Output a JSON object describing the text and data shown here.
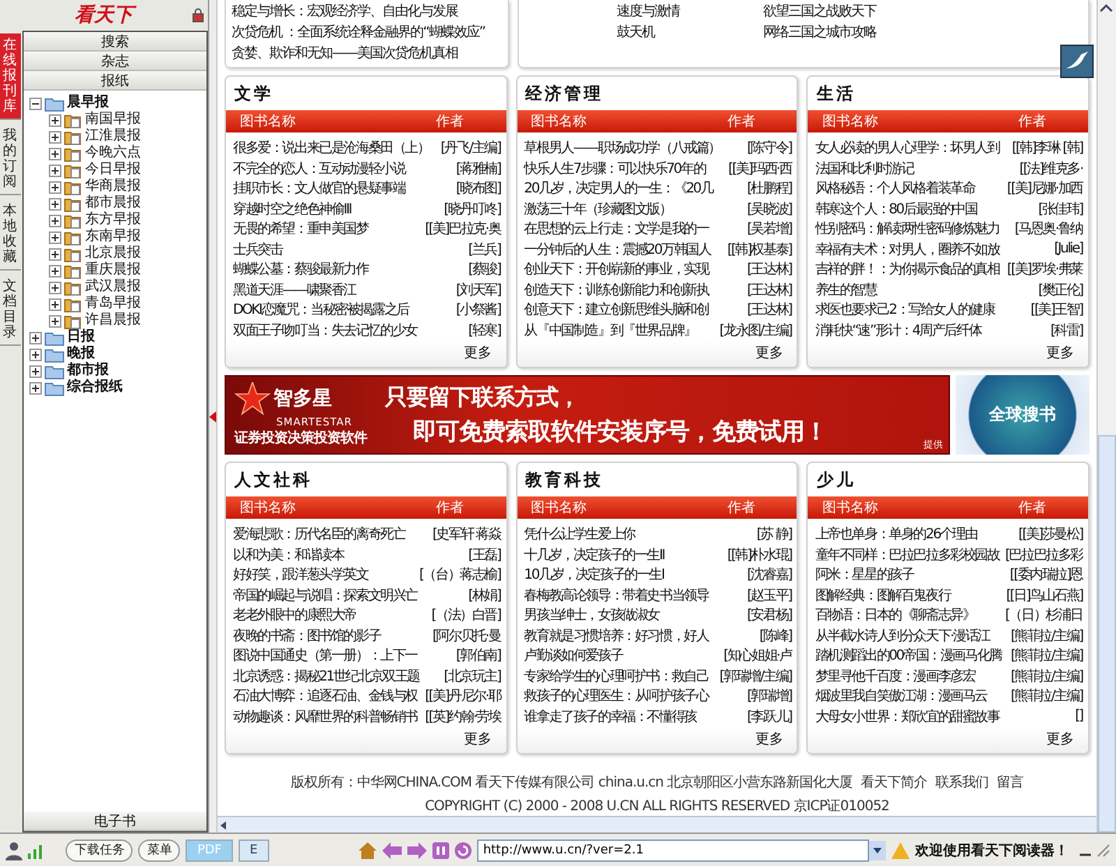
{
  "sidebar": {
    "logo": "看天下",
    "side_tabs": [
      {
        "label": "在线报刊库",
        "selected": true
      },
      {
        "label": "我的订阅",
        "selected": false
      },
      {
        "label": "本地收藏",
        "selected": false
      },
      {
        "label": "文档目录",
        "selected": false
      }
    ],
    "sections": [
      {
        "label": "搜索"
      },
      {
        "label": "杂志"
      },
      {
        "label": "报纸"
      }
    ],
    "tree": [
      {
        "label": "晨早报",
        "expanded": true,
        "children": [
          {
            "label": "南国早报",
            "expanded": false
          },
          {
            "label": "江淮晨报",
            "expanded": false
          },
          {
            "label": "今晚六点",
            "expanded": false
          },
          {
            "label": "今日早报",
            "expanded": false
          },
          {
            "label": "华商晨报",
            "expanded": false
          },
          {
            "label": "都市晨报",
            "expanded": false
          },
          {
            "label": "东方早报",
            "expanded": false
          },
          {
            "label": "东南早报",
            "expanded": false
          },
          {
            "label": "北京晨报",
            "expanded": false
          },
          {
            "label": "重庆晨报",
            "expanded": false
          },
          {
            "label": "武汉晨报",
            "expanded": false
          },
          {
            "label": "青岛早报",
            "expanded": false
          },
          {
            "label": "许昌晨报",
            "expanded": false
          }
        ]
      },
      {
        "label": "日报",
        "expanded": false
      },
      {
        "label": "晚报",
        "expanded": false
      },
      {
        "label": "都市报",
        "expanded": false
      },
      {
        "label": "综合报纸",
        "expanded": false
      }
    ],
    "bottom_section": "电子书"
  },
  "top_cards": {
    "left_lines": [
      "稳定与增长：宏观经济学、自由化与发展",
      "次贷危机 ：全面系统诠释金融界的“蝴蝶效应”",
      "贪婪、欺诈和无知——美国次贷危机真相"
    ],
    "right_column_1": [
      "速度与激情",
      "鼓天机"
    ],
    "right_column_2": [
      "欲望三国之战败天下",
      "网络三国之城市攻略"
    ]
  },
  "book_panels_1": [
    {
      "title": "文学",
      "columns": [
        "图书名称",
        "作者"
      ],
      "more": "更多",
      "rows": [
        {
          "title": "很多爱：说出来已是沧海桑田（上）",
          "author": "[丹飞/主编]"
        },
        {
          "title": "不完全的恋人：互动动漫轻小说",
          "author": "[蒋雅楠]"
        },
        {
          "title": "挂职市长：文人做官的悬疑事端",
          "author": "[晓布图]"
        },
        {
          "title": "穿越时空之绝色神偷III",
          "author": "[晓丹叮咚]"
        },
        {
          "title": "无畏的希望：重申美国梦",
          "author": "[[美]巴拉克·奥"
        },
        {
          "title": "士兵突击",
          "author": "[兰兵]"
        },
        {
          "title": "蝴蝶公墓：蔡骏最新力作",
          "author": "[蔡骏]"
        },
        {
          "title": "黑道天涯——啸聚香江",
          "author": "[刘天军]"
        },
        {
          "title": "DOKI恋魔咒：当秘密被揭露之后",
          "author": "[小祭酱]"
        },
        {
          "title": "双面王子吻叮当：失去记忆的少女",
          "author": "[轻寒]"
        }
      ]
    },
    {
      "title": "经济管理",
      "columns": [
        "图书名称",
        "作者"
      ],
      "more": "更多",
      "rows": [
        {
          "title": "草根男人——职场成功学（八戒篇）",
          "author": "[陈守令]"
        },
        {
          "title": "快乐人生7步骤：可以快乐70年的",
          "author": "[[美]玛西·西"
        },
        {
          "title": "20几岁，决定男人的一生：《20几",
          "author": "[杜鹏程]"
        },
        {
          "title": "激荡三十年（珍藏图文版）",
          "author": "[吴晓波]"
        },
        {
          "title": "在思想的云上行走：文学是我的一",
          "author": "[吴若增]"
        },
        {
          "title": "一分钟后的人生：震撼20万韩国人",
          "author": "[[韩]权基泰]"
        },
        {
          "title": "创业天下：开创崭新的事业，实现",
          "author": "[王达林]"
        },
        {
          "title": "创造天下：训练创新能力和创新执",
          "author": "[王达林]"
        },
        {
          "title": "创意天下：建立创新思维头脑和创",
          "author": "[王达林]"
        },
        {
          "title": "从『中国制造』到『世界品牌』",
          "author": "[龙永图/主编]"
        }
      ]
    },
    {
      "title": "生活",
      "columns": [
        "图书名称",
        "作者"
      ],
      "more": "更多",
      "rows": [
        {
          "title": "女人必读的男人心理学：坏男人到",
          "author": "[[韩]李琳 [韩]"
        },
        {
          "title": "法国和比利时游记",
          "author": "[[法]维克多·"
        },
        {
          "title": "风格秘语：个人风格着装革命",
          "author": "[[美]尼娜·加西"
        },
        {
          "title": "韩寒这个人：80后最强的中国",
          "author": "[张佳玮]"
        },
        {
          "title": "性别密码：解读两性密码修炼魅力",
          "author": "[马恩奥·鲁纳"
        },
        {
          "title": "幸福有夫术：对男人，圈养不如放",
          "author": "[Julie]"
        },
        {
          "title": "吉祥的胖！：为你揭示食品的真相",
          "author": "[[美]罗埃·弗莱"
        },
        {
          "title": "养生的智慧",
          "author": "[樊正伦]"
        },
        {
          "title": "求医也要求己2：写给女人的健康",
          "author": "[[美]王智]"
        },
        {
          "title": "消耗快“速”形计：4周产后纤体",
          "author": "[科雷]"
        }
      ]
    }
  ],
  "ad_banner": {
    "brand": "智多星",
    "brand_latin": "SMARTESTAR",
    "tagline": "证券投资决策投资软件",
    "headline_1": "只要留下联系方式，",
    "headline_2": "即可免费索取软件安装序号，免费试用！",
    "credit": "提供",
    "side_badge": "全球搜书"
  },
  "book_panels_2": [
    {
      "title": "人文社科",
      "columns": [
        "图书名称",
        "作者"
      ],
      "more": "更多",
      "rows": [
        {
          "title": "爱海悲歌：历代名臣的离奇死亡",
          "author": "[史军轩 蒋焱"
        },
        {
          "title": "以和为美：和谐读本",
          "author": "[王磊]"
        },
        {
          "title": "好好笑，跟洋葱头学英文",
          "author": "[（台）蒋志榆]"
        },
        {
          "title": "帝国的崛起与说唱：探索文明兴亡",
          "author": "[林娟]"
        },
        {
          "title": "老老外眼中的康熙大帝",
          "author": "[（法）白晋]"
        },
        {
          "title": "夜晚的书斋：图书馆的影子",
          "author": "[阿尔贝托·曼"
        },
        {
          "title": "图说中国通史（第一册）：上下一",
          "author": "[郭伯南]"
        },
        {
          "title": "北京诱惑：揭秘21世纪北京双王题",
          "author": "[北京玩主]"
        },
        {
          "title": "石油大博弈：追逐石油、金钱与权",
          "author": "[[美]丹尼尔·耶"
        },
        {
          "title": "动物趣谈：风靡世界的科普畅销书",
          "author": "[[英]约翰·劳埃"
        }
      ]
    },
    {
      "title": "教育科技",
      "columns": [
        "图书名称",
        "作者"
      ],
      "more": "更多",
      "rows": [
        {
          "title": "凭什么让学生爱上你",
          "author": "[苏 静]"
        },
        {
          "title": "十几岁，决定孩子的一生II",
          "author": "[[韩]朴水琨]"
        },
        {
          "title": "10几岁，决定孩子的一生I",
          "author": "[沈睿嘉]"
        },
        {
          "title": "春梅教高论领导：带着史书当领导",
          "author": "[赵玉平]"
        },
        {
          "title": "男孩当绅士，女孩做淑女",
          "author": "[安君杨]"
        },
        {
          "title": "教育就是习惯培养：好习惯，好人",
          "author": "[陈峰]"
        },
        {
          "title": "卢勤谈如何爱孩子",
          "author": "[知心姐姐·卢"
        },
        {
          "title": "专家给学生的心理呵护书：救自己",
          "author": "[郭瑞增/主编]"
        },
        {
          "title": "救孩子的心理医生：从呵护孩子心",
          "author": "[郭瑞增]"
        },
        {
          "title": "谁拿走了孩子的幸福：不懂得孩",
          "author": "[李跃儿]"
        }
      ]
    },
    {
      "title": "少儿",
      "columns": [
        "图书名称",
        "作者"
      ],
      "more": "更多",
      "rows": [
        {
          "title": "上帝也单身：单身的26个理由",
          "author": "[[美]莎曼松]"
        },
        {
          "title": "童年不同样：巴拉巴拉多彩校园故",
          "author": "[巴拉巴拉多彩"
        },
        {
          "title": "阿米：星星的孩子",
          "author": "[[委内瑞拉]恩"
        },
        {
          "title": "图解经典：图解百鬼夜行",
          "author": "[[日]鸟山石燕]"
        },
        {
          "title": "百物语：日本的《聊斋志异》",
          "author": "[（日）杉浦日"
        },
        {
          "title": "从半截水诗人到分众天下·漫话江",
          "author": "[熊菲拉/主编]"
        },
        {
          "title": "踏机测蹈出的00帝国：漫画马化腾",
          "author": "[熊菲拉/主编]"
        },
        {
          "title": "梦里寻他千百度：漫画李彦宏",
          "author": "[熊菲拉/主编]"
        },
        {
          "title": "烟波里我自笑傲江湖：漫画马云",
          "author": "[熊菲拉/主编]"
        },
        {
          "title": "大母女小世界：郑欣宜的甜蜜故事",
          "author": "[]"
        }
      ]
    }
  ],
  "footer": {
    "owner_text": "版权所有：中华网CHINA.COM 看天下传媒有限公司 china.u.cn 北京朝阳区小营东路新国化大厦",
    "links": [
      "看天下简介",
      "联系我们",
      "留言"
    ],
    "copyright": "COPYRIGHT (C) 2000 - 2008 U.CN ALL RIGHTS RESERVED 京ICP证010052"
  },
  "status_bar": {
    "download_button": "下载任务",
    "menu_button": "菜单",
    "mode_tabs": [
      {
        "label": "PDF",
        "selected": true
      },
      {
        "label": "E",
        "selected": false
      }
    ],
    "address": "http://www.u.cn/?ver=2.1",
    "welcome": "欢迎使用看天下阅读器！"
  }
}
